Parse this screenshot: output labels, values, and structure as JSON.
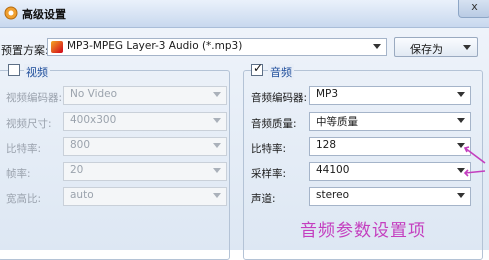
{
  "window": {
    "title": "高级设置",
    "close_glyph": "x"
  },
  "preset": {
    "label": "预置方案:",
    "value": "MP3-MPEG Layer-3 Audio (*.mp3)",
    "icon": "mp3-file-icon",
    "saveas_label": "保存为"
  },
  "video": {
    "title": "视频",
    "enabled": false,
    "rows": [
      {
        "label": "视频编码器:",
        "value": "No Video"
      },
      {
        "label": "视频尺寸:",
        "value": "400x300"
      },
      {
        "label": "比特率:",
        "value": "800"
      },
      {
        "label": "帧率:",
        "value": "20"
      },
      {
        "label": "宽高比:",
        "value": "auto"
      }
    ]
  },
  "audio": {
    "title": "音频",
    "enabled": true,
    "rows": [
      {
        "label": "音频编码器:",
        "value": "MP3"
      },
      {
        "label": "音频质量:",
        "value": "中等质量"
      },
      {
        "label": "比特率:",
        "value": "128"
      },
      {
        "label": "采样率:",
        "value": "44100"
      },
      {
        "label": "声道:",
        "value": "stereo"
      }
    ]
  },
  "annotation": {
    "text": "音频参数设置项",
    "color": "#c43fbf"
  },
  "colors": {
    "titlebar": "#c8d8ee",
    "group_title": "#1f4e9c",
    "disabled_text": "#9ba3ad"
  }
}
